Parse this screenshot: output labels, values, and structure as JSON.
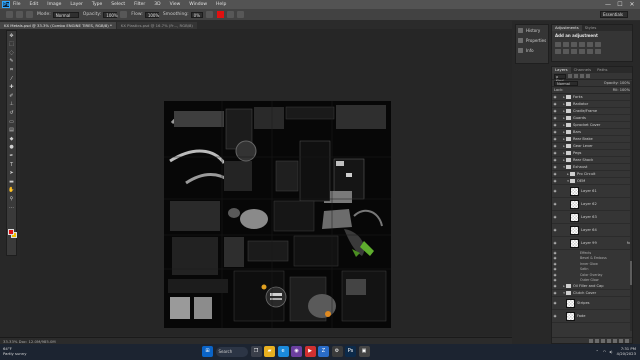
{
  "menubar": {
    "app_icon": "Ps",
    "items": [
      "File",
      "Edit",
      "Image",
      "Layer",
      "Type",
      "Select",
      "Filter",
      "3D",
      "View",
      "Window",
      "Help"
    ],
    "window_controls": [
      "—",
      "☐",
      "✕"
    ]
  },
  "options": {
    "mode_label": "Mode:",
    "mode_value": "Normal",
    "opacity_label": "Opacity:",
    "opacity_value": "100%",
    "flow_label": "Flow:",
    "flow_value": "100%",
    "smoothing_label": "Smoothing:",
    "smoothing_value": "0%",
    "workspace": "Essentials"
  },
  "document": {
    "tabs": [
      "KX Metals.psd @ 33.3% (Combo ENGINE TIRES, RGB/8) *",
      "KX Plastics.psd @ 16.7% (Fr..., RGB/8)"
    ],
    "status": "33.33%    Doc: 12.0M/985.0M"
  },
  "mini_panels": [
    "History",
    "Properties",
    "Info"
  ],
  "adjustments": {
    "tabs": [
      "Adjustments",
      "Styles"
    ],
    "title": "Add an adjustment"
  },
  "layers": {
    "tabs": [
      "Layers",
      "Channels",
      "Paths"
    ],
    "filter_label": "ρ Kind",
    "blend_mode": "Normal",
    "opacity": "Opacity: 100%",
    "lock_label": "Lock:",
    "fill": "Fill: 100%",
    "rows": [
      {
        "type": "group",
        "name": "Forks",
        "indent": 1
      },
      {
        "type": "group",
        "name": "Radiator",
        "indent": 1
      },
      {
        "type": "group",
        "name": "Cradle/Frame",
        "indent": 1
      },
      {
        "type": "group",
        "name": "Guards",
        "indent": 1
      },
      {
        "type": "group",
        "name": "Sprocket Cover",
        "indent": 1
      },
      {
        "type": "group",
        "name": "Bars",
        "indent": 1
      },
      {
        "type": "group",
        "name": "Rear Brake",
        "indent": 1
      },
      {
        "type": "group",
        "name": "Gear Lever",
        "indent": 1
      },
      {
        "type": "group",
        "name": "Pegs",
        "indent": 1
      },
      {
        "type": "group",
        "name": "Rear Shock",
        "indent": 1
      },
      {
        "type": "group",
        "name": "Exhaust",
        "indent": 1,
        "open": true
      },
      {
        "type": "group",
        "name": "Pro Circuit",
        "indent": 2
      },
      {
        "type": "group",
        "name": "OEM",
        "indent": 2,
        "open": true
      },
      {
        "type": "layer",
        "name": "Layer 61",
        "indent": 3
      },
      {
        "type": "layer",
        "name": "Layer 62",
        "indent": 3
      },
      {
        "type": "layer",
        "name": "Layer 63",
        "indent": 3
      },
      {
        "type": "layer",
        "name": "Layer 64",
        "indent": 3
      },
      {
        "type": "layer",
        "name": "Layer 99",
        "indent": 3,
        "fx": true
      },
      {
        "type": "fx",
        "name": "Effects"
      },
      {
        "type": "fx",
        "name": "Bevel & Emboss"
      },
      {
        "type": "fx",
        "name": "Inner Glow"
      },
      {
        "type": "fx",
        "name": "Satin"
      },
      {
        "type": "fx",
        "name": "Color Overlay"
      },
      {
        "type": "fx",
        "name": "Outer Glow"
      },
      {
        "type": "group",
        "name": "Oil Filler and Cap",
        "indent": 1
      },
      {
        "type": "group",
        "name": "Clutch Cover",
        "indent": 1,
        "open": true
      },
      {
        "type": "layer",
        "name": "Stripes",
        "indent": 2
      },
      {
        "type": "layer",
        "name": "Fade",
        "indent": 2
      }
    ]
  },
  "taskbar": {
    "weather_temp": "64°F",
    "weather_desc": "Partly sunny",
    "search": "Search",
    "time": "7:31 PM",
    "date": "4/20/2023"
  },
  "colors": {
    "foreground": "#e01010",
    "background": "#f0c000",
    "accent": "#31a8ff"
  }
}
